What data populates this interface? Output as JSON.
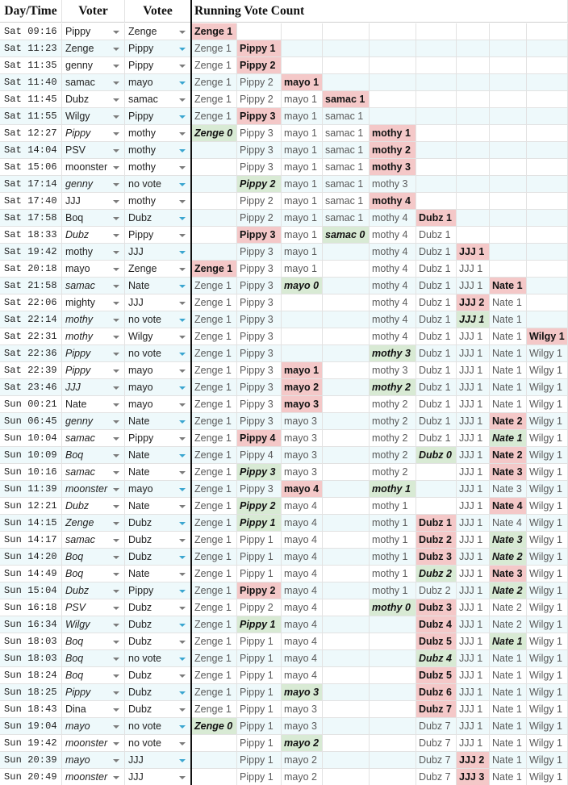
{
  "headers": {
    "day_time": "Day/Time",
    "voter": "Voter",
    "votee": "Votee",
    "running": "Running Vote Count"
  },
  "colors": {
    "row_alt": "#eef9fb",
    "highlight_vote": "#f4c8c8",
    "highlight_unvote": "#d8ead4",
    "dropdown_arrow_blue": "#3aa6d0",
    "dropdown_arrow_gray": "#7b7b7b"
  },
  "icons": {
    "dropdown": "chevron-down-icon"
  },
  "rows": [
    {
      "time": "Sat 09:16",
      "voter": "Pippy",
      "vi": false,
      "votee": "Zenge",
      "ab": false,
      "counts": [
        [
          "Zenge 1",
          "r"
        ],
        "",
        "",
        "",
        "",
        "",
        "",
        "",
        ""
      ]
    },
    {
      "time": "Sat 11:23",
      "voter": "Zenge",
      "vi": false,
      "votee": "Pippy",
      "ab": true,
      "counts": [
        "Zenge 1",
        [
          "Pippy 1",
          "r"
        ],
        "",
        "",
        "",
        "",
        "",
        "",
        ""
      ]
    },
    {
      "time": "Sat 11:35",
      "voter": "genny",
      "vi": false,
      "votee": "Pippy",
      "ab": false,
      "counts": [
        "Zenge 1",
        [
          "Pippy 2",
          "r"
        ],
        "",
        "",
        "",
        "",
        "",
        "",
        ""
      ]
    },
    {
      "time": "Sat 11:40",
      "voter": "samac",
      "vi": false,
      "votee": "mayo",
      "ab": true,
      "counts": [
        "Zenge 1",
        "Pippy 2",
        [
          "mayo 1",
          "r"
        ],
        "",
        "",
        "",
        "",
        "",
        ""
      ]
    },
    {
      "time": "Sat 11:45",
      "voter": "Dubz",
      "vi": false,
      "votee": "samac",
      "ab": false,
      "counts": [
        "Zenge 1",
        "Pippy 2",
        "mayo 1",
        [
          "samac 1",
          "r"
        ],
        "",
        "",
        "",
        "",
        ""
      ]
    },
    {
      "time": "Sat 11:55",
      "voter": "Wilgy",
      "vi": false,
      "votee": "Pippy",
      "ab": true,
      "counts": [
        "Zenge 1",
        [
          "Pippy 3",
          "r"
        ],
        "mayo 1",
        "samac 1",
        "",
        "",
        "",
        "",
        ""
      ]
    },
    {
      "time": "Sat 12:27",
      "voter": "Pippy",
      "vi": true,
      "votee": "mothy",
      "ab": false,
      "counts": [
        [
          "Zenge 0",
          "g"
        ],
        "Pippy 3",
        "mayo 1",
        "samac 1",
        [
          "mothy 1",
          "r"
        ],
        "",
        "",
        "",
        ""
      ]
    },
    {
      "time": "Sat 14:04",
      "voter": "PSV",
      "vi": false,
      "votee": "mothy",
      "ab": true,
      "counts": [
        "",
        "Pippy 3",
        "mayo 1",
        "samac 1",
        [
          "mothy 2",
          "r"
        ],
        "",
        "",
        "",
        ""
      ]
    },
    {
      "time": "Sat 15:06",
      "voter": "moonster",
      "vi": false,
      "votee": "mothy",
      "ab": false,
      "counts": [
        "",
        "Pippy 3",
        "mayo 1",
        "samac 1",
        [
          "mothy 3",
          "r"
        ],
        "",
        "",
        "",
        ""
      ]
    },
    {
      "time": "Sat 17:14",
      "voter": "genny",
      "vi": true,
      "votee": "no vote",
      "ab": true,
      "counts": [
        "",
        [
          "Pippy 2",
          "g"
        ],
        "mayo 1",
        "samac 1",
        "mothy 3",
        "",
        "",
        "",
        ""
      ]
    },
    {
      "time": "Sat 17:40",
      "voter": "JJJ",
      "vi": false,
      "votee": "mothy",
      "ab": false,
      "counts": [
        "",
        "Pippy 2",
        "mayo 1",
        "samac 1",
        [
          "mothy 4",
          "r"
        ],
        "",
        "",
        "",
        ""
      ]
    },
    {
      "time": "Sat 17:58",
      "voter": "Boq",
      "vi": false,
      "votee": "Dubz",
      "ab": true,
      "counts": [
        "",
        "Pippy 2",
        "mayo 1",
        "samac 1",
        "mothy 4",
        [
          "Dubz 1",
          "r"
        ],
        "",
        "",
        ""
      ]
    },
    {
      "time": "Sat 18:33",
      "voter": "Dubz",
      "vi": true,
      "votee": "Pippy",
      "ab": false,
      "counts": [
        "",
        [
          "Pippy 3",
          "r"
        ],
        "mayo 1",
        [
          "samac 0",
          "g"
        ],
        "mothy 4",
        "Dubz 1",
        "",
        "",
        ""
      ]
    },
    {
      "time": "Sat 19:42",
      "voter": "mothy",
      "vi": false,
      "votee": "JJJ",
      "ab": true,
      "counts": [
        "",
        "Pippy 3",
        "mayo 1",
        "",
        "mothy 4",
        "Dubz 1",
        [
          "JJJ 1",
          "r"
        ],
        "",
        ""
      ]
    },
    {
      "time": "Sat 20:18",
      "voter": "mayo",
      "vi": false,
      "votee": "Zenge",
      "ab": false,
      "counts": [
        [
          "Zenge 1",
          "r"
        ],
        "Pippy 3",
        "mayo 1",
        "",
        "mothy 4",
        "Dubz 1",
        "JJJ 1",
        "",
        ""
      ]
    },
    {
      "time": "Sat 21:58",
      "voter": "samac",
      "vi": true,
      "votee": "Nate",
      "ab": true,
      "counts": [
        "Zenge 1",
        "Pippy 3",
        [
          "mayo 0",
          "g"
        ],
        "",
        "mothy 4",
        "Dubz 1",
        "JJJ 1",
        [
          "Nate 1",
          "r"
        ],
        ""
      ]
    },
    {
      "time": "Sat 22:06",
      "voter": "mighty",
      "vi": false,
      "votee": "JJJ",
      "ab": false,
      "counts": [
        "Zenge 1",
        "Pippy 3",
        "",
        "",
        "mothy 4",
        "Dubz 1",
        [
          "JJJ 2",
          "r"
        ],
        "Nate 1",
        ""
      ]
    },
    {
      "time": "Sat 22:14",
      "voter": "mothy",
      "vi": true,
      "votee": "no vote",
      "ab": true,
      "counts": [
        "Zenge 1",
        "Pippy 3",
        "",
        "",
        "mothy 4",
        "Dubz 1",
        [
          "JJJ 1",
          "g"
        ],
        "Nate 1",
        ""
      ]
    },
    {
      "time": "Sat 22:31",
      "voter": "mothy",
      "vi": true,
      "votee": "Wilgy",
      "ab": false,
      "counts": [
        "Zenge 1",
        "Pippy 3",
        "",
        "",
        "mothy 4",
        "Dubz 1",
        "JJJ 1",
        "Nate 1",
        [
          "Wilgy 1",
          "r"
        ]
      ]
    },
    {
      "time": "Sat 22:36",
      "voter": "Pippy",
      "vi": true,
      "votee": "no vote",
      "ab": true,
      "counts": [
        "Zenge 1",
        "Pippy 3",
        "",
        "",
        [
          "mothy 3",
          "g"
        ],
        "Dubz 1",
        "JJJ 1",
        "Nate 1",
        "Wilgy 1"
      ]
    },
    {
      "time": "Sat 22:39",
      "voter": "Pippy",
      "vi": true,
      "votee": "mayo",
      "ab": false,
      "counts": [
        "Zenge 1",
        "Pippy 3",
        [
          "mayo 1",
          "r"
        ],
        "",
        "mothy 3",
        "Dubz 1",
        "JJJ 1",
        "Nate 1",
        "Wilgy 1"
      ]
    },
    {
      "time": "Sat 23:46",
      "voter": "JJJ",
      "vi": true,
      "votee": "mayo",
      "ab": true,
      "counts": [
        "Zenge 1",
        "Pippy 3",
        [
          "mayo 2",
          "r"
        ],
        "",
        [
          "mothy 2",
          "g"
        ],
        "Dubz 1",
        "JJJ 1",
        "Nate 1",
        "Wilgy 1"
      ]
    },
    {
      "time": "Sun 00:21",
      "voter": "Nate",
      "vi": false,
      "votee": "mayo",
      "ab": false,
      "counts": [
        "Zenge 1",
        "Pippy 3",
        [
          "mayo 3",
          "r"
        ],
        "",
        "mothy 2",
        "Dubz 1",
        "JJJ 1",
        "Nate 1",
        "Wilgy 1"
      ]
    },
    {
      "time": "Sun 06:45",
      "voter": "genny",
      "vi": true,
      "votee": "Nate",
      "ab": true,
      "counts": [
        "Zenge 1",
        "Pippy 3",
        "mayo 3",
        "",
        "mothy 2",
        "Dubz 1",
        "JJJ 1",
        [
          "Nate 2",
          "r"
        ],
        "Wilgy 1"
      ]
    },
    {
      "time": "Sun 10:04",
      "voter": "samac",
      "vi": true,
      "votee": "Pippy",
      "ab": false,
      "counts": [
        "Zenge 1",
        [
          "Pippy 4",
          "r"
        ],
        "mayo 3",
        "",
        "mothy 2",
        "Dubz 1",
        "JJJ 1",
        [
          "Nate 1",
          "g"
        ],
        "Wilgy 1"
      ]
    },
    {
      "time": "Sun 10:09",
      "voter": "Boq",
      "vi": true,
      "votee": "Nate",
      "ab": true,
      "counts": [
        "Zenge 1",
        "Pippy 4",
        "mayo 3",
        "",
        "mothy 2",
        [
          "Dubz 0",
          "g"
        ],
        "JJJ 1",
        [
          "Nate 2",
          "r"
        ],
        "Wilgy 1"
      ]
    },
    {
      "time": "Sun 10:16",
      "voter": "samac",
      "vi": true,
      "votee": "Nate",
      "ab": false,
      "counts": [
        "Zenge 1",
        [
          "Pippy 3",
          "g"
        ],
        "mayo 3",
        "",
        "mothy 2",
        "",
        "JJJ 1",
        [
          "Nate 3",
          "r"
        ],
        "Wilgy 1"
      ]
    },
    {
      "time": "Sun 11:39",
      "voter": "moonster",
      "vi": true,
      "votee": "mayo",
      "ab": true,
      "counts": [
        "Zenge 1",
        "Pippy 3",
        [
          "mayo 4",
          "r"
        ],
        "",
        [
          "mothy 1",
          "g"
        ],
        "",
        "JJJ 1",
        "Nate 3",
        "Wilgy 1"
      ]
    },
    {
      "time": "Sun 12:21",
      "voter": "Dubz",
      "vi": true,
      "votee": "Nate",
      "ab": false,
      "counts": [
        "Zenge 1",
        [
          "Pippy 2",
          "g"
        ],
        "mayo 4",
        "",
        "mothy 1",
        "",
        "JJJ 1",
        [
          "Nate 4",
          "r"
        ],
        "Wilgy 1"
      ]
    },
    {
      "time": "Sun 14:15",
      "voter": "Zenge",
      "vi": true,
      "votee": "Dubz",
      "ab": true,
      "counts": [
        "Zenge 1",
        [
          "Pippy 1",
          "g"
        ],
        "mayo 4",
        "",
        "mothy 1",
        [
          "Dubz 1",
          "r"
        ],
        "JJJ 1",
        "Nate 4",
        "Wilgy 1"
      ]
    },
    {
      "time": "Sun 14:17",
      "voter": "samac",
      "vi": true,
      "votee": "Dubz",
      "ab": false,
      "counts": [
        "Zenge 1",
        "Pippy 1",
        "mayo 4",
        "",
        "mothy 1",
        [
          "Dubz 2",
          "r"
        ],
        "JJJ 1",
        [
          "Nate 3",
          "g"
        ],
        "Wilgy 1"
      ]
    },
    {
      "time": "Sun 14:20",
      "voter": "Boq",
      "vi": true,
      "votee": "Dubz",
      "ab": true,
      "counts": [
        "Zenge 1",
        "Pippy 1",
        "mayo 4",
        "",
        "mothy 1",
        [
          "Dubz 3",
          "r"
        ],
        "JJJ 1",
        [
          "Nate 2",
          "g"
        ],
        "Wilgy 1"
      ]
    },
    {
      "time": "Sun 14:49",
      "voter": "Boq",
      "vi": true,
      "votee": "Nate",
      "ab": false,
      "counts": [
        "Zenge 1",
        "Pippy 1",
        "mayo 4",
        "",
        "mothy 1",
        [
          "Dubz 2",
          "g"
        ],
        "JJJ 1",
        [
          "Nate 3",
          "r"
        ],
        "Wilgy 1"
      ]
    },
    {
      "time": "Sun 15:04",
      "voter": "Dubz",
      "vi": true,
      "votee": "Pippy",
      "ab": true,
      "counts": [
        "Zenge 1",
        [
          "Pippy 2",
          "r"
        ],
        "mayo 4",
        "",
        "mothy 1",
        "Dubz 2",
        "JJJ 1",
        [
          "Nate 2",
          "g"
        ],
        "Wilgy 1"
      ]
    },
    {
      "time": "Sun 16:18",
      "voter": "PSV",
      "vi": true,
      "votee": "Dubz",
      "ab": false,
      "counts": [
        "Zenge 1",
        "Pippy 2",
        "mayo 4",
        "",
        [
          "mothy 0",
          "g"
        ],
        [
          "Dubz 3",
          "r"
        ],
        "JJJ 1",
        "Nate 2",
        "Wilgy 1"
      ]
    },
    {
      "time": "Sun 16:34",
      "voter": "Wilgy",
      "vi": true,
      "votee": "Dubz",
      "ab": true,
      "counts": [
        "Zenge 1",
        [
          "Pippy 1",
          "g"
        ],
        "mayo 4",
        "",
        "",
        [
          "Dubz 4",
          "r"
        ],
        "JJJ 1",
        "Nate 2",
        "Wilgy 1"
      ]
    },
    {
      "time": "Sun 18:03",
      "voter": "Boq",
      "vi": true,
      "votee": "Dubz",
      "ab": false,
      "counts": [
        "Zenge 1",
        "Pippy 1",
        "mayo 4",
        "",
        "",
        [
          "Dubz 5",
          "r"
        ],
        "JJJ 1",
        [
          "Nate 1",
          "g"
        ],
        "Wilgy 1"
      ]
    },
    {
      "time": "Sun 18:03",
      "voter": "Boq",
      "vi": true,
      "votee": "no vote",
      "ab": true,
      "counts": [
        "Zenge 1",
        "Pippy 1",
        "mayo 4",
        "",
        "",
        [
          "Dubz 4",
          "g"
        ],
        "JJJ 1",
        "Nate 1",
        "Wilgy 1"
      ]
    },
    {
      "time": "Sun 18:24",
      "voter": "Boq",
      "vi": true,
      "votee": "Dubz",
      "ab": false,
      "counts": [
        "Zenge 1",
        "Pippy 1",
        "mayo 4",
        "",
        "",
        [
          "Dubz 5",
          "r"
        ],
        "JJJ 1",
        "Nate 1",
        "Wilgy 1"
      ]
    },
    {
      "time": "Sun 18:25",
      "voter": "Pippy",
      "vi": true,
      "votee": "Dubz",
      "ab": true,
      "counts": [
        "Zenge 1",
        "Pippy 1",
        [
          "mayo 3",
          "g"
        ],
        "",
        "",
        [
          "Dubz 6",
          "r"
        ],
        "JJJ 1",
        "Nate 1",
        "Wilgy 1"
      ]
    },
    {
      "time": "Sun 18:43",
      "voter": "Dina",
      "vi": false,
      "votee": "Dubz",
      "ab": false,
      "counts": [
        "Zenge 1",
        "Pippy 1",
        "mayo 3",
        "",
        "",
        [
          "Dubz 7",
          "r"
        ],
        "JJJ 1",
        "Nate 1",
        "Wilgy 1"
      ]
    },
    {
      "time": "Sun 19:04",
      "voter": "mayo",
      "vi": true,
      "votee": "no vote",
      "ab": true,
      "counts": [
        [
          "Zenge 0",
          "g"
        ],
        "Pippy 1",
        "mayo 3",
        "",
        "",
        "Dubz 7",
        "JJJ 1",
        "Nate 1",
        "Wilgy 1"
      ]
    },
    {
      "time": "Sun 19:42",
      "voter": "moonster",
      "vi": true,
      "votee": "no vote",
      "ab": false,
      "counts": [
        "",
        "Pippy 1",
        [
          "mayo 2",
          "g"
        ],
        "",
        "",
        "Dubz 7",
        "JJJ 1",
        "Nate 1",
        "Wilgy 1"
      ]
    },
    {
      "time": "Sun 20:39",
      "voter": "mayo",
      "vi": true,
      "votee": "JJJ",
      "ab": true,
      "counts": [
        "",
        "Pippy 1",
        "mayo 2",
        "",
        "",
        "Dubz 7",
        [
          "JJJ 2",
          "r"
        ],
        "Nate 1",
        "Wilgy 1"
      ]
    },
    {
      "time": "Sun 20:49",
      "voter": "moonster",
      "vi": true,
      "votee": "JJJ",
      "ab": false,
      "counts": [
        "",
        "Pippy 1",
        "mayo 2",
        "",
        "",
        "Dubz 7",
        [
          "JJJ 3",
          "r"
        ],
        "Nate 1",
        "Wilgy 1"
      ]
    }
  ]
}
